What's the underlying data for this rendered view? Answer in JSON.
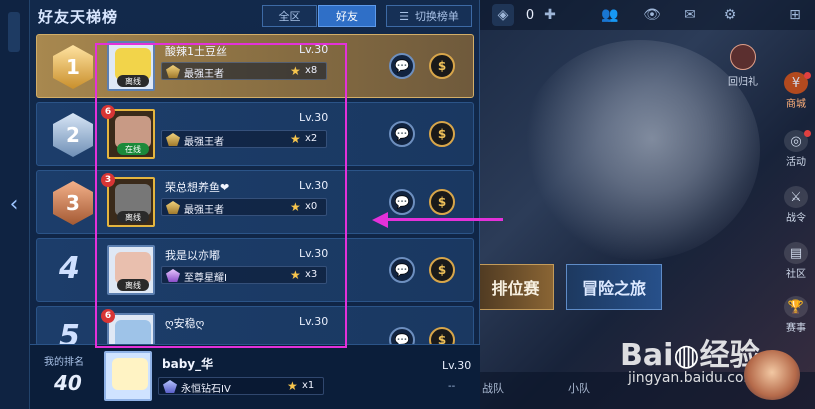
{
  "panel": {
    "title": "好友天梯榜",
    "tabs": [
      {
        "label": "全区",
        "active": false
      },
      {
        "label": "好友",
        "active": true
      }
    ],
    "switch_button": "切换榜单"
  },
  "rows": [
    {
      "rank": "1",
      "name": "酸辣1土豆丝",
      "level": "Lv.30",
      "rank_tier": "最强王者",
      "stars": "x8",
      "status": "离线",
      "avatar_level": ""
    },
    {
      "rank": "2",
      "name": "",
      "level": "Lv.30",
      "rank_tier": "最强王者",
      "stars": "x2",
      "status": "在线",
      "avatar_level": "6"
    },
    {
      "rank": "3",
      "name": "荣总想养鱼❤",
      "level": "Lv.30",
      "rank_tier": "最强王者",
      "stars": "x0",
      "status": "离线",
      "avatar_level": "3"
    },
    {
      "rank": "4",
      "name": "我是以亦嘟",
      "level": "Lv.30",
      "rank_tier": "至尊星耀I",
      "stars": "x3",
      "status": "离线",
      "avatar_level": ""
    },
    {
      "rank": "5",
      "name": "ღ安稳ღ",
      "level": "Lv.30",
      "rank_tier": "",
      "stars": "",
      "status": "",
      "avatar_level": "6"
    }
  ],
  "my_rank": {
    "label": "我的排名",
    "number": "40",
    "name": "baby_华",
    "level": "Lv.30",
    "rank_tier": "永恒钻石IV",
    "stars": "x1",
    "extra": "--"
  },
  "right_side": {
    "top_value": "0",
    "huigui_label": "回归礼",
    "side_items": [
      "商城",
      "活动",
      "战令",
      "社区",
      "赛事"
    ],
    "mode_rank": "排位赛",
    "mode_adventure": "冒险之旅",
    "bottom_nav": [
      "战队",
      "小队"
    ]
  },
  "watermark": {
    "logo": "Baidu经验",
    "url": "jingyan.baidu.com"
  },
  "colors": {
    "highlight": "#e331d9",
    "gold": "#d2ae68",
    "panel_bg": "#12294b"
  },
  "icons": [
    "back-chevron-icon",
    "menu-list-icon",
    "message-icon",
    "gift-coin-icon",
    "star-icon",
    "rank-tier-icon",
    "wifi-icon",
    "mail-icon",
    "gear-icon",
    "friends-icon",
    "eye-icon"
  ]
}
